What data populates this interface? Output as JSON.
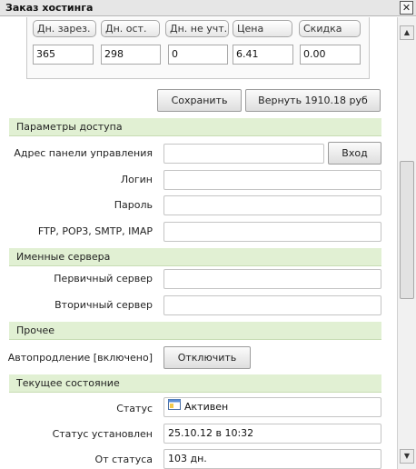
{
  "window": {
    "title": "Заказ хостинга",
    "close_glyph": "✕"
  },
  "pricing": {
    "columns": [
      {
        "header": "Дн. зарез.",
        "value": "365"
      },
      {
        "header": "Дн. ост.",
        "value": "298"
      },
      {
        "header": "Дн. не учт.",
        "value": "0"
      },
      {
        "header": "Цена",
        "value": "6.41"
      },
      {
        "header": "Скидка",
        "value": "0.00"
      }
    ],
    "save_label": "Сохранить",
    "refund_label": "Вернуть 1910.18 руб"
  },
  "access": {
    "section_title": "Параметры доступа",
    "panel_address_label": "Адрес панели управления",
    "panel_address_value": "",
    "login_button_label": "Вход",
    "login_label": "Логин",
    "login_value": "",
    "password_label": "Пароль",
    "password_value": "",
    "ftp_label": "FTP, POP3, SMTP, IMAP",
    "ftp_value": ""
  },
  "nameservers": {
    "section_title": "Именные сервера",
    "primary_label": "Первичный сервер",
    "primary_value": "",
    "secondary_label": "Вторичный сервер",
    "secondary_value": ""
  },
  "other": {
    "section_title": "Прочее",
    "autorenew_label": "Автопродление [включено]",
    "disable_button_label": "Отключить"
  },
  "state": {
    "section_title": "Текущее состояние",
    "status_label": "Статус",
    "status_value": "Активен",
    "status_icon": "window-icon",
    "status_set_label": "Статус установлен",
    "status_set_value": "25.10.12 в 10:32",
    "since_status_label": "От статуса",
    "since_status_value": "103 дн."
  },
  "colors": {
    "section_bg": "#e1f0d3",
    "titlebar_bg": "#e6e6e6"
  }
}
